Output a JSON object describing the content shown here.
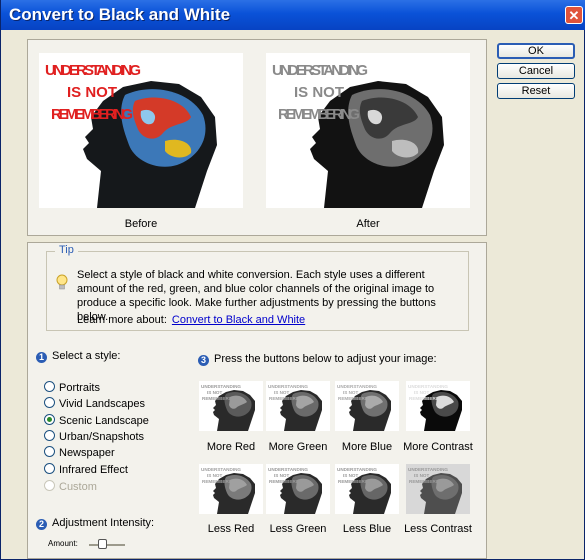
{
  "window": {
    "title": "Convert to Black and White",
    "close_glyph": "✕"
  },
  "buttons": {
    "ok": "OK",
    "cancel": "Cancel",
    "reset": "Reset"
  },
  "preview": {
    "before_label": "Before",
    "after_label": "After",
    "poster_line1": "UNDERSTANDING",
    "poster_line2": "IS NOT",
    "poster_line3": "REMEMBERING",
    "thumb_line1": "UNDERSTANDING",
    "thumb_line2": "IS NOT",
    "thumb_line3": "REMEMBERING"
  },
  "tip": {
    "title": "Tip",
    "text": "Select a style of black and white conversion. Each style uses a different amount of the red, green, and blue color channels of the original image to produce a specific look. Make further adjustments by pressing the buttons below.",
    "learn_more_prefix": "Learn more about:",
    "learn_more_link": "Convert to Black and White"
  },
  "styles": {
    "step_number": "1",
    "label": "Select a style:",
    "options": [
      {
        "label": "Portraits",
        "checked": false,
        "disabled": false
      },
      {
        "label": "Vivid Landscapes",
        "checked": false,
        "disabled": false
      },
      {
        "label": "Scenic Landscape",
        "checked": true,
        "disabled": false
      },
      {
        "label": "Urban/Snapshots",
        "checked": false,
        "disabled": false
      },
      {
        "label": "Newspaper",
        "checked": false,
        "disabled": false
      },
      {
        "label": "Infrared Effect",
        "checked": false,
        "disabled": false
      },
      {
        "label": "Custom",
        "checked": false,
        "disabled": true
      }
    ]
  },
  "adjust": {
    "step_number": "3",
    "label": "Press the buttons below to adjust your image:",
    "more": [
      "More Red",
      "More Green",
      "More Blue",
      "More Contrast"
    ],
    "less": [
      "Less Red",
      "Less Green",
      "Less Blue",
      "Less Contrast"
    ]
  },
  "intensity": {
    "step_number": "2",
    "label": "Adjustment Intensity:",
    "amount_label": "Amount:"
  },
  "colors": {
    "title_bar": "#0a52d8",
    "link": "#0000cc",
    "panel_bg": "#f3f2ec"
  }
}
